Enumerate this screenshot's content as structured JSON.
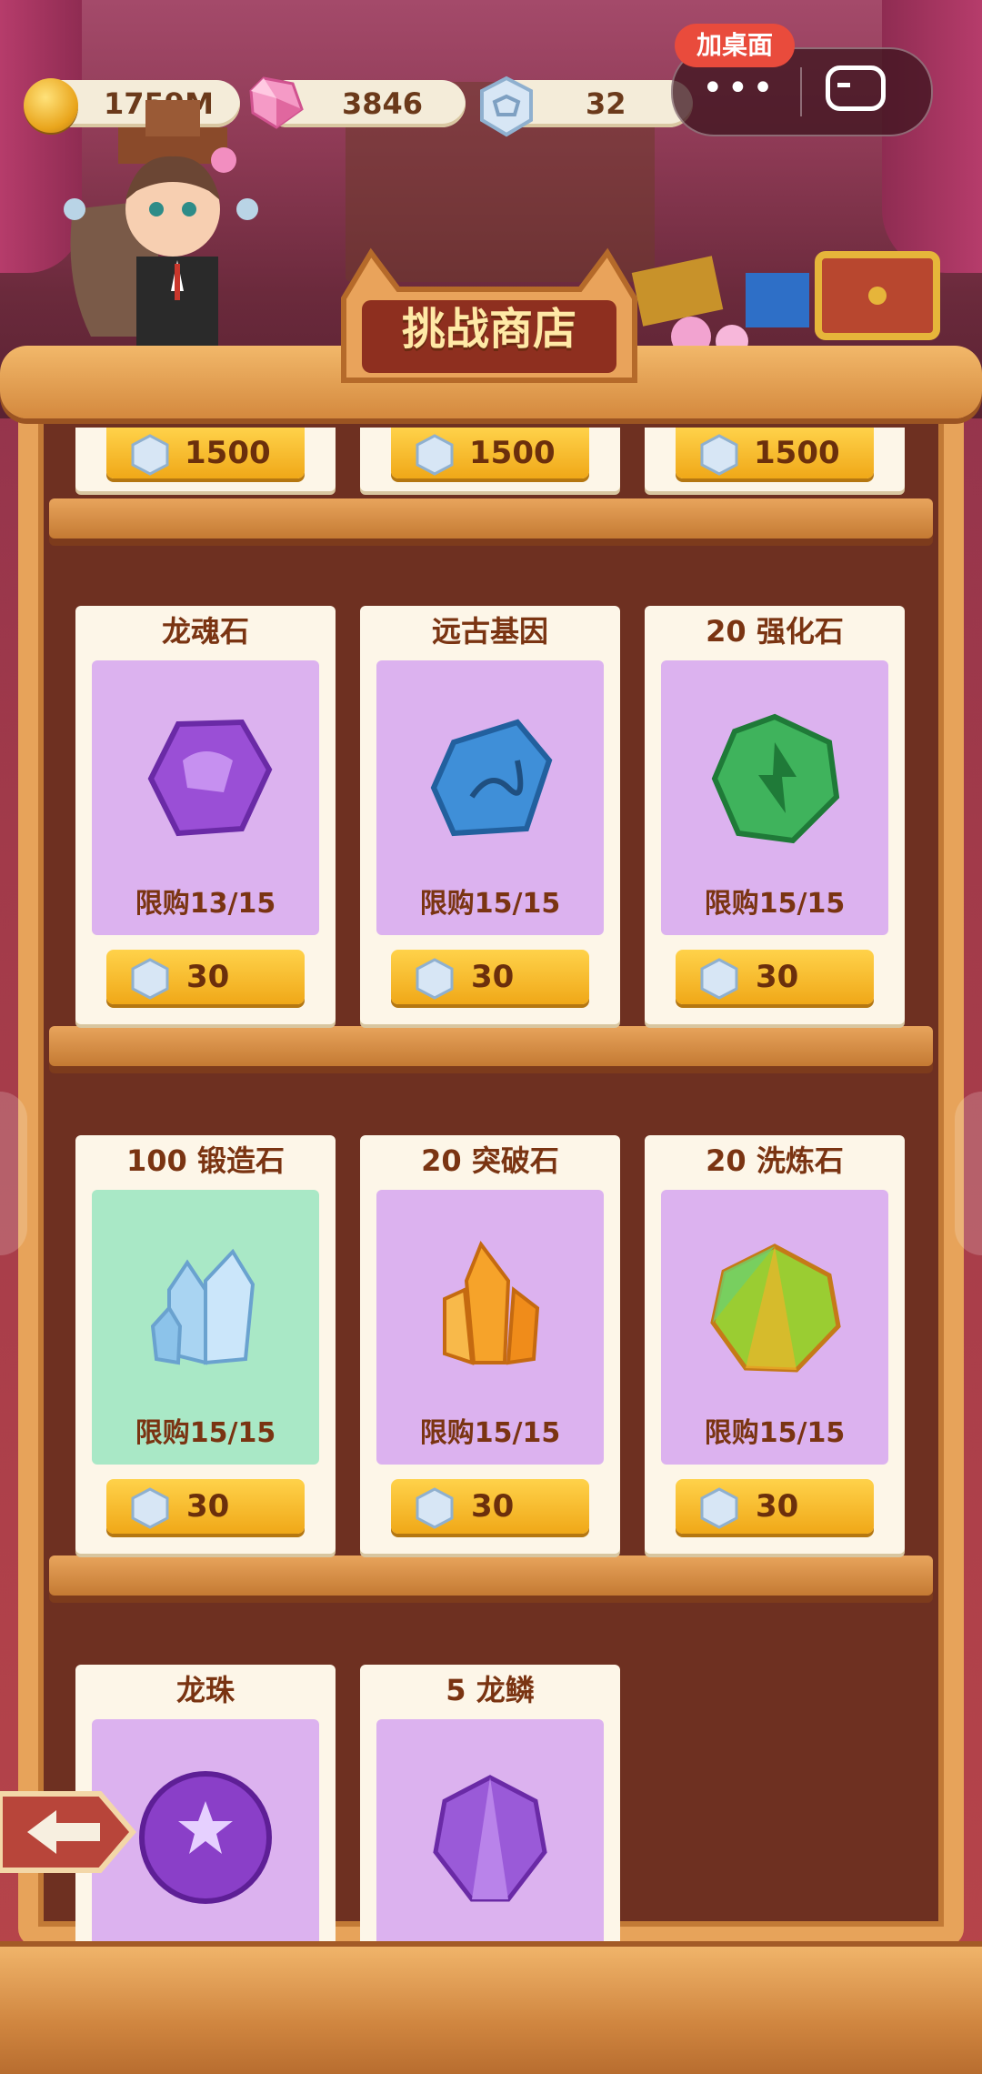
{
  "topbar": {
    "gold": "1759M",
    "gems": "3846",
    "tickets": "32",
    "add_desktop": "加桌面",
    "more_label": "•••"
  },
  "shop": {
    "title": "挑战商店",
    "partial_row": [
      {
        "price": "1500"
      },
      {
        "price": "1500"
      },
      {
        "price": "1500"
      }
    ],
    "rows": [
      [
        {
          "name": "龙魂石",
          "limit": "限购13/15",
          "price": "30",
          "icon": "dragon-soul-stone-icon"
        },
        {
          "name": "远古基因",
          "limit": "限购15/15",
          "price": "30",
          "icon": "ancient-gene-icon"
        },
        {
          "name": "20 强化石",
          "limit": "限购15/15",
          "price": "30",
          "icon": "enhance-stone-icon"
        }
      ],
      [
        {
          "name": "100 锻造石",
          "limit": "限购15/15",
          "price": "30",
          "icon": "forge-stone-icon"
        },
        {
          "name": "20 突破石",
          "limit": "限购15/15",
          "price": "30",
          "icon": "breakthrough-stone-icon"
        },
        {
          "name": "20 洗炼石",
          "limit": "限购15/15",
          "price": "30",
          "icon": "refine-stone-icon"
        }
      ],
      [
        {
          "name": "龙珠",
          "icon": "dragon-orb-icon"
        },
        {
          "name": "5 龙鳞",
          "icon": "dragon-scale-icon"
        }
      ]
    ]
  },
  "colors": {
    "card_bg": "#fdf6e8",
    "purple_box": "#dcb2ef",
    "green_box": "#a9e8c6",
    "buy_button": "#f0a818",
    "text_brown": "#7a3412"
  }
}
